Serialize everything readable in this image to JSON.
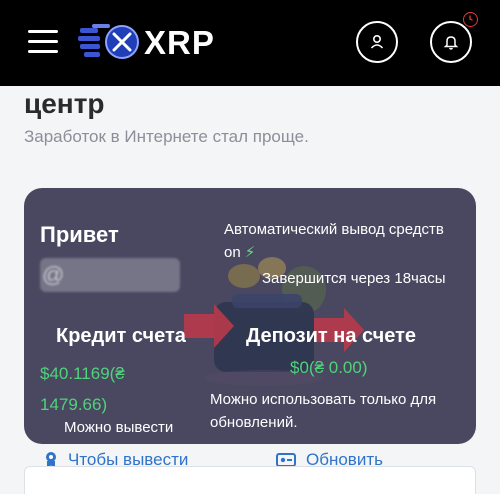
{
  "header": {
    "logo_text": "XRP"
  },
  "page": {
    "title": "центр",
    "subtitle": "Заработок в Интернете стал проще."
  },
  "card": {
    "greeting": "Привет",
    "username_masked": "@",
    "auto_withdraw": "Автоматический вывод средств on",
    "ends_in": "Завершится через 18часы",
    "credit": {
      "title": "Кредит счета",
      "value": "$40.1169(₴ 1479.66)",
      "note": "Можно вывести"
    },
    "deposit": {
      "title": "Депозит на счете",
      "value": "$0(₴ 0.00)",
      "note": "Можно использовать только для обновлений."
    }
  },
  "actions": {
    "withdraw": "Чтобы вывести",
    "refresh": "Обновить"
  },
  "colors": {
    "header_bg": "#000000",
    "card_bg": "#4a4860",
    "accent_green": "#4fd27a",
    "link_blue": "#2f74c9",
    "notif_red": "#e53935"
  },
  "icons": {
    "menu": "hamburger-menu-icon",
    "user": "user-icon",
    "bell": "bell-icon",
    "bolt": "lightning-bolt-icon",
    "withdraw": "medal-icon",
    "refresh": "card-icon"
  }
}
